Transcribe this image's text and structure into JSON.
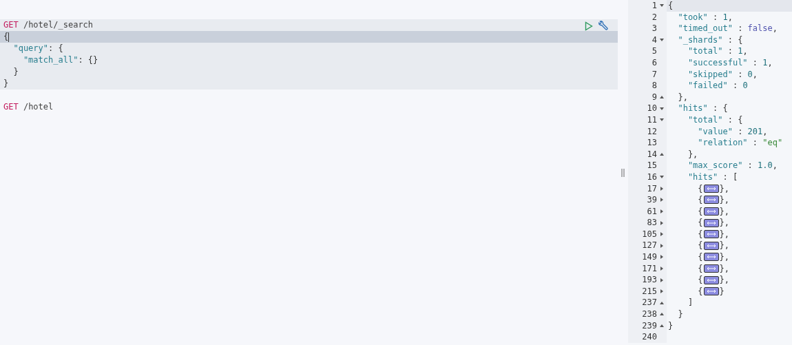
{
  "request_editor": {
    "requests": [
      {
        "selected": true,
        "lines": [
          {
            "active": false,
            "tokens": [
              {
                "kind": "method",
                "text": "GET"
              },
              {
                "kind": "path",
                "text": " /hotel/_search"
              }
            ]
          },
          {
            "active": true,
            "tokens": [
              {
                "kind": "punct",
                "text": "{"
              }
            ]
          },
          {
            "active": false,
            "tokens": [
              {
                "kind": "key",
                "text": "  \"query\""
              },
              {
                "kind": "punct",
                "text": ": {"
              }
            ]
          },
          {
            "active": false,
            "tokens": [
              {
                "kind": "key",
                "text": "    \"match_all\""
              },
              {
                "kind": "punct",
                "text": ": {}"
              }
            ]
          },
          {
            "active": false,
            "tokens": [
              {
                "kind": "punct",
                "text": "  }"
              }
            ]
          },
          {
            "active": false,
            "tokens": [
              {
                "kind": "punct",
                "text": "}"
              }
            ]
          }
        ]
      },
      {
        "selected": false,
        "lines": [
          {
            "active": false,
            "tokens": [
              {
                "kind": "method",
                "text": "GET"
              },
              {
                "kind": "path",
                "text": " /hotel"
              }
            ]
          }
        ]
      }
    ]
  },
  "response_viewer": {
    "lines": [
      {
        "number": "1",
        "kind": "fold_start",
        "active": true,
        "tokens": [
          {
            "kind": "punct",
            "text": "{"
          }
        ]
      },
      {
        "number": "2",
        "kind": "plain",
        "active": false,
        "tokens": [
          {
            "kind": "key",
            "text": "  \"took\""
          },
          {
            "kind": "punct",
            "text": " : "
          },
          {
            "kind": "number",
            "text": "1"
          },
          {
            "kind": "punct",
            "text": ","
          }
        ]
      },
      {
        "number": "3",
        "kind": "plain",
        "active": false,
        "tokens": [
          {
            "kind": "key",
            "text": "  \"timed_out\""
          },
          {
            "kind": "punct",
            "text": " : "
          },
          {
            "kind": "bool",
            "text": "false"
          },
          {
            "kind": "punct",
            "text": ","
          }
        ]
      },
      {
        "number": "4",
        "kind": "fold_start",
        "active": false,
        "tokens": [
          {
            "kind": "key",
            "text": "  \"_shards\""
          },
          {
            "kind": "punct",
            "text": " : {"
          }
        ]
      },
      {
        "number": "5",
        "kind": "plain",
        "active": false,
        "tokens": [
          {
            "kind": "key",
            "text": "    \"total\""
          },
          {
            "kind": "punct",
            "text": " : "
          },
          {
            "kind": "number",
            "text": "1"
          },
          {
            "kind": "punct",
            "text": ","
          }
        ]
      },
      {
        "number": "6",
        "kind": "plain",
        "active": false,
        "tokens": [
          {
            "kind": "key",
            "text": "    \"successful\""
          },
          {
            "kind": "punct",
            "text": " : "
          },
          {
            "kind": "number",
            "text": "1"
          },
          {
            "kind": "punct",
            "text": ","
          }
        ]
      },
      {
        "number": "7",
        "kind": "plain",
        "active": false,
        "tokens": [
          {
            "kind": "key",
            "text": "    \"skipped\""
          },
          {
            "kind": "punct",
            "text": " : "
          },
          {
            "kind": "number",
            "text": "0"
          },
          {
            "kind": "punct",
            "text": ","
          }
        ]
      },
      {
        "number": "8",
        "kind": "plain",
        "active": false,
        "tokens": [
          {
            "kind": "key",
            "text": "    \"failed\""
          },
          {
            "kind": "punct",
            "text": " : "
          },
          {
            "kind": "number",
            "text": "0"
          }
        ]
      },
      {
        "number": "9",
        "kind": "fold_end",
        "active": false,
        "tokens": [
          {
            "kind": "punct",
            "text": "  },"
          }
        ]
      },
      {
        "number": "10",
        "kind": "fold_start",
        "active": false,
        "tokens": [
          {
            "kind": "key",
            "text": "  \"hits\""
          },
          {
            "kind": "punct",
            "text": " : {"
          }
        ]
      },
      {
        "number": "11",
        "kind": "fold_start",
        "active": false,
        "tokens": [
          {
            "kind": "key",
            "text": "    \"total\""
          },
          {
            "kind": "punct",
            "text": " : {"
          }
        ]
      },
      {
        "number": "12",
        "kind": "plain",
        "active": false,
        "tokens": [
          {
            "kind": "key",
            "text": "      \"value\""
          },
          {
            "kind": "punct",
            "text": " : "
          },
          {
            "kind": "number",
            "text": "201"
          },
          {
            "kind": "punct",
            "text": ","
          }
        ]
      },
      {
        "number": "13",
        "kind": "plain",
        "active": false,
        "tokens": [
          {
            "kind": "key",
            "text": "      \"relation\""
          },
          {
            "kind": "punct",
            "text": " : "
          },
          {
            "kind": "string",
            "text": "\"eq\""
          }
        ]
      },
      {
        "number": "14",
        "kind": "fold_end",
        "active": false,
        "tokens": [
          {
            "kind": "punct",
            "text": "    },"
          }
        ]
      },
      {
        "number": "15",
        "kind": "plain",
        "active": false,
        "tokens": [
          {
            "kind": "key",
            "text": "    \"max_score\""
          },
          {
            "kind": "punct",
            "text": " : "
          },
          {
            "kind": "number",
            "text": "1.0"
          },
          {
            "kind": "punct",
            "text": ","
          }
        ]
      },
      {
        "number": "16",
        "kind": "fold_start",
        "active": false,
        "tokens": [
          {
            "kind": "key",
            "text": "    \"hits\""
          },
          {
            "kind": "punct",
            "text": " : ["
          }
        ]
      },
      {
        "number": "17",
        "kind": "collapsed",
        "active": false,
        "tokens": [
          {
            "kind": "punct",
            "text": "      {"
          },
          {
            "kind": "folded"
          },
          {
            "kind": "punct",
            "text": "},"
          }
        ]
      },
      {
        "number": "39",
        "kind": "collapsed",
        "active": false,
        "tokens": [
          {
            "kind": "punct",
            "text": "      {"
          },
          {
            "kind": "folded"
          },
          {
            "kind": "punct",
            "text": "},"
          }
        ]
      },
      {
        "number": "61",
        "kind": "collapsed",
        "active": false,
        "tokens": [
          {
            "kind": "punct",
            "text": "      {"
          },
          {
            "kind": "folded"
          },
          {
            "kind": "punct",
            "text": "},"
          }
        ]
      },
      {
        "number": "83",
        "kind": "collapsed",
        "active": false,
        "tokens": [
          {
            "kind": "punct",
            "text": "      {"
          },
          {
            "kind": "folded"
          },
          {
            "kind": "punct",
            "text": "},"
          }
        ]
      },
      {
        "number": "105",
        "kind": "collapsed",
        "active": false,
        "tokens": [
          {
            "kind": "punct",
            "text": "      {"
          },
          {
            "kind": "folded"
          },
          {
            "kind": "punct",
            "text": "},"
          }
        ]
      },
      {
        "number": "127",
        "kind": "collapsed",
        "active": false,
        "tokens": [
          {
            "kind": "punct",
            "text": "      {"
          },
          {
            "kind": "folded"
          },
          {
            "kind": "punct",
            "text": "},"
          }
        ]
      },
      {
        "number": "149",
        "kind": "collapsed",
        "active": false,
        "tokens": [
          {
            "kind": "punct",
            "text": "      {"
          },
          {
            "kind": "folded"
          },
          {
            "kind": "punct",
            "text": "},"
          }
        ]
      },
      {
        "number": "171",
        "kind": "collapsed",
        "active": false,
        "tokens": [
          {
            "kind": "punct",
            "text": "      {"
          },
          {
            "kind": "folded"
          },
          {
            "kind": "punct",
            "text": "},"
          }
        ]
      },
      {
        "number": "193",
        "kind": "collapsed",
        "active": false,
        "tokens": [
          {
            "kind": "punct",
            "text": "      {"
          },
          {
            "kind": "folded"
          },
          {
            "kind": "punct",
            "text": "},"
          }
        ]
      },
      {
        "number": "215",
        "kind": "collapsed",
        "active": false,
        "tokens": [
          {
            "kind": "punct",
            "text": "      {"
          },
          {
            "kind": "folded"
          },
          {
            "kind": "punct",
            "text": "}"
          }
        ]
      },
      {
        "number": "237",
        "kind": "fold_end",
        "active": false,
        "tokens": [
          {
            "kind": "punct",
            "text": "    ]"
          }
        ]
      },
      {
        "number": "238",
        "kind": "fold_end",
        "active": false,
        "tokens": [
          {
            "kind": "punct",
            "text": "  }"
          }
        ]
      },
      {
        "number": "239",
        "kind": "fold_end",
        "active": false,
        "tokens": [
          {
            "kind": "punct",
            "text": "}"
          }
        ]
      },
      {
        "number": "240",
        "kind": "plain",
        "active": false
      }
    ]
  }
}
